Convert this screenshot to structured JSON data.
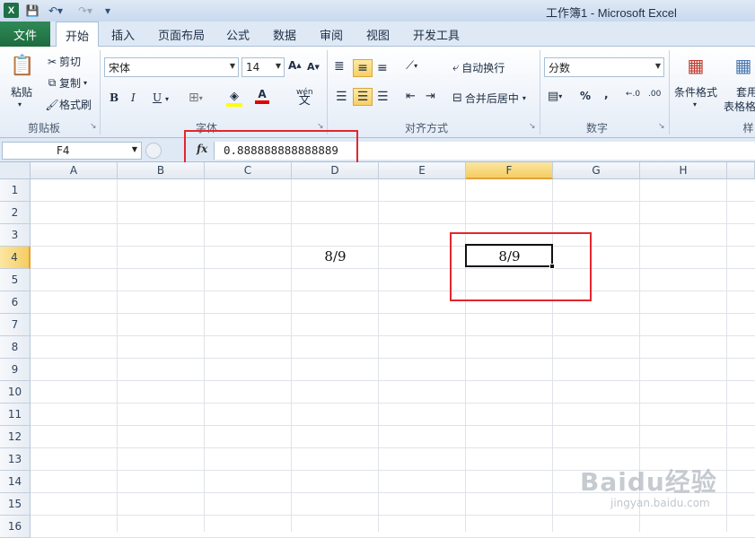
{
  "window": {
    "title": "工作簿1 - Microsoft Excel",
    "app_icon_letter": "X"
  },
  "tabs": [
    {
      "label": "文件"
    },
    {
      "label": "开始"
    },
    {
      "label": "插入"
    },
    {
      "label": "页面布局"
    },
    {
      "label": "公式"
    },
    {
      "label": "数据"
    },
    {
      "label": "审阅"
    },
    {
      "label": "视图"
    },
    {
      "label": "开发工具"
    }
  ],
  "ribbon": {
    "clipboard": {
      "paste": "粘贴",
      "cut": "剪切",
      "copy": "复制",
      "format_painter": "格式刷",
      "group_label": "剪贴板"
    },
    "font": {
      "font_name": "宋体",
      "font_size": "14",
      "bold": "B",
      "italic": "I",
      "underline": "U",
      "phonetic": "wén",
      "group_label": "字体"
    },
    "alignment": {
      "wrap_text": "自动换行",
      "merge_center": "合并后居中",
      "group_label": "对齐方式"
    },
    "number": {
      "format": "分数",
      "percent": "%",
      "comma": ",",
      "group_label": "数字"
    },
    "styles": {
      "conditional_format": "条件格式",
      "table_format_line1": "套用",
      "table_format_line2": "表格格",
      "group_label": "样"
    }
  },
  "formula_bar": {
    "name_box": "F4",
    "fx": "fx",
    "value": "0.888888888888889"
  },
  "columns": [
    "A",
    "B",
    "C",
    "D",
    "E",
    "F",
    "G",
    "H"
  ],
  "rows": [
    "1",
    "2",
    "3",
    "4",
    "5",
    "6",
    "7",
    "8",
    "9",
    "10",
    "11",
    "12",
    "13",
    "14",
    "15",
    "16"
  ],
  "cells": {
    "D4": "8/9",
    "F4": "8/9"
  },
  "selected": {
    "column": "F",
    "row": "4"
  },
  "watermark": {
    "logo": "Baidu经验",
    "url": "jingyan.baidu.com"
  },
  "colors": {
    "file_tab": "#217346",
    "highlight_box": "#e3262e",
    "selection_header": "#f5cd62"
  }
}
